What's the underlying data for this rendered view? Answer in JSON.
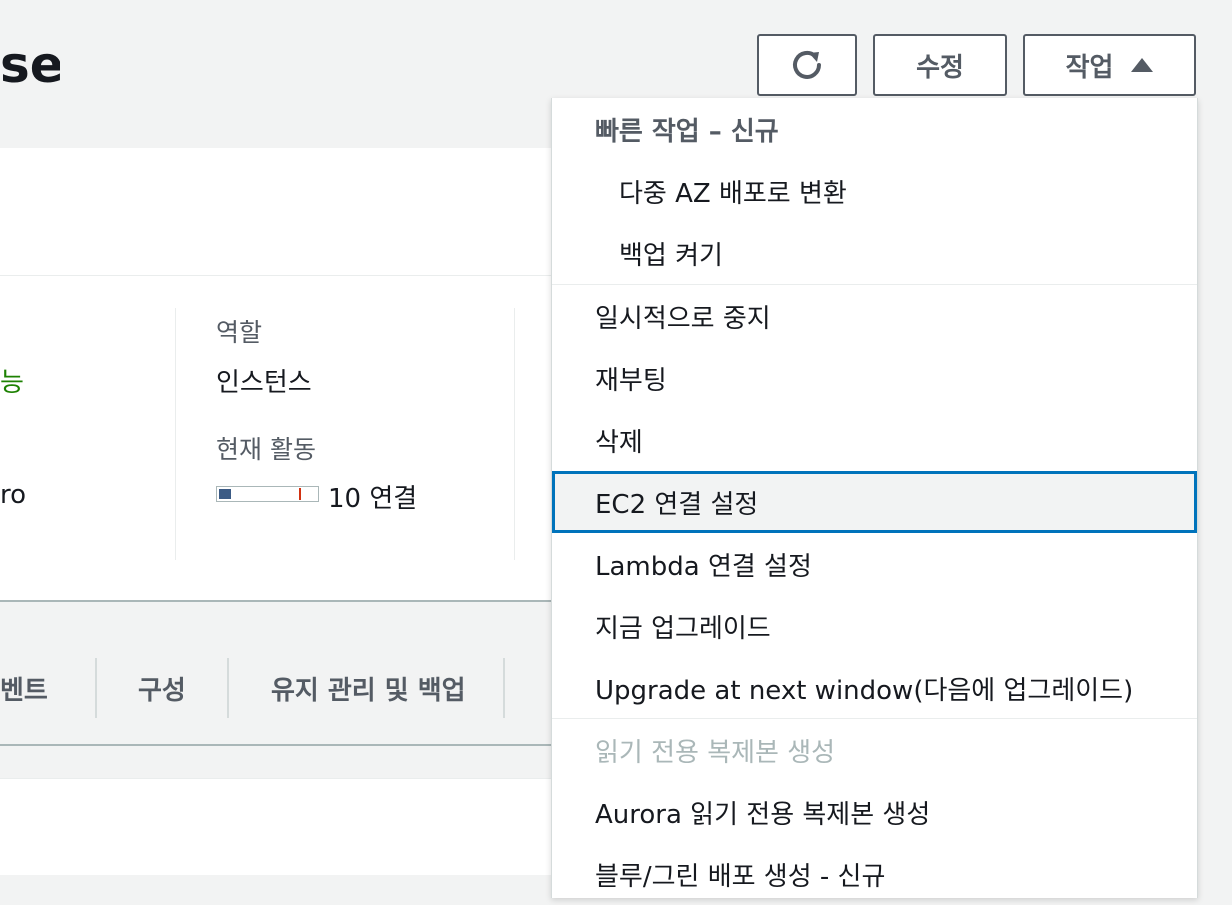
{
  "page": {
    "title": "se"
  },
  "header": {
    "refresh_icon": "refresh-icon",
    "edit_label": "수정",
    "actions_label": "작업",
    "actions_icon": "caret-up-icon"
  },
  "summary": {
    "status_fragment": "능",
    "class_fragment": "ro",
    "role_label": "역할",
    "role_value": "인스턴스",
    "activity_label": "현재 활동",
    "activity_value": "10 연결",
    "activity_level": 0.12
  },
  "tabs": [
    {
      "label": "벤트"
    },
    {
      "label": "구성"
    },
    {
      "label": "유지 관리 및 백업"
    }
  ],
  "actions_menu": {
    "group_header": "빠른 작업 – 신규",
    "items": [
      {
        "label": "다중 AZ 배포로 변환"
      },
      {
        "label": "백업 켜기"
      },
      {
        "label": "일시적으로 중지"
      },
      {
        "label": "재부팅"
      },
      {
        "label": "삭제"
      },
      {
        "label": "EC2 연결 설정"
      },
      {
        "label": "Lambda 연결 설정"
      },
      {
        "label": "지금 업그레이드"
      },
      {
        "label": "Upgrade at next window(다음에 업그레이드)"
      },
      {
        "label": "읽기 전용 복제본 생성"
      },
      {
        "label": "Aurora 읽기 전용 복제본 생성"
      },
      {
        "label": "블루/그린 배포 생성 - 신규"
      }
    ]
  },
  "colors": {
    "accent_focus": "#0073bb",
    "status_green": "#1d8102",
    "meter_fill": "#3b5b85",
    "meter_mark": "#d13212"
  }
}
